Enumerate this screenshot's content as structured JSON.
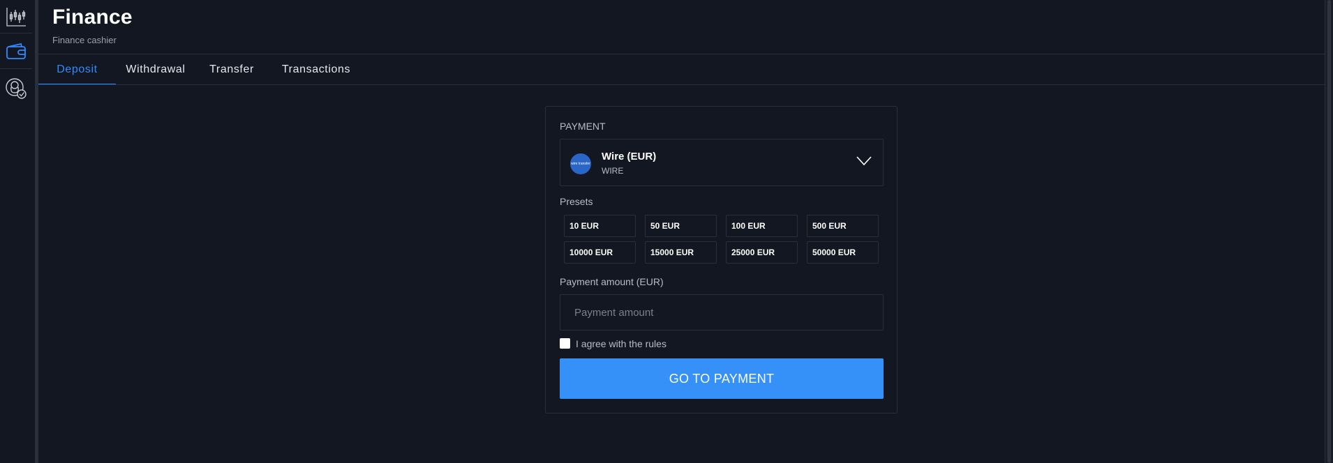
{
  "header": {
    "title": "Finance",
    "subtitle": "Finance cashier"
  },
  "rail": {
    "items": [
      {
        "icon": "chart-icon",
        "active": false
      },
      {
        "icon": "wallet-icon",
        "active": true
      },
      {
        "icon": "user-verified-icon",
        "active": false
      }
    ]
  },
  "tabs": [
    {
      "label": "Deposit",
      "active": true
    },
    {
      "label": "Withdrawal",
      "active": false
    },
    {
      "label": "Transfer",
      "active": false
    },
    {
      "label": "Transactions",
      "active": false
    }
  ],
  "payment": {
    "section_label": "PAYMENT",
    "method_name": "Wire (EUR)",
    "method_code": "WIRE",
    "method_logo_text": "wire transfer",
    "presets_label": "Presets",
    "presets": [
      "10 EUR",
      "50 EUR",
      "100 EUR",
      "500 EUR",
      "10000 EUR",
      "15000 EUR",
      "25000 EUR",
      "50000 EUR"
    ],
    "amount_label": "Payment amount (EUR)",
    "amount_placeholder": "Payment amount",
    "amount_value": "",
    "agree_label": "I agree with the rules",
    "agree_checked": false,
    "submit_label": "GO TO PAYMENT"
  },
  "colors": {
    "background": "#131722",
    "accent": "#2f8cff",
    "button": "#3590f8",
    "border": "#2a2f3c"
  }
}
